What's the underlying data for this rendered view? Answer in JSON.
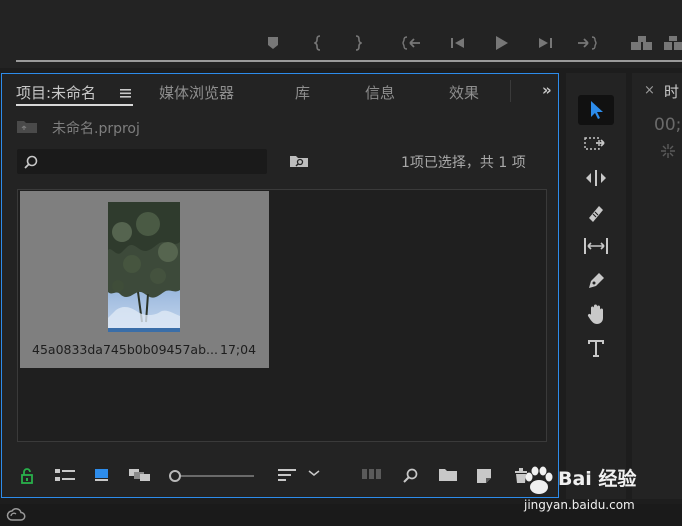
{
  "project_panel": {
    "tabs": [
      {
        "label": "项目:未命名"
      },
      {
        "label": "媒体浏览器"
      },
      {
        "label": "库"
      },
      {
        "label": "信息"
      },
      {
        "label": "效果"
      }
    ],
    "overflow_label": "»",
    "path": "未命名.prproj",
    "search": {
      "value": "",
      "placeholder": ""
    },
    "selection_info": "1项已选择，共 1 项",
    "items": [
      {
        "name": "45a0833da745b0b09457ab...",
        "duration": "17;04"
      }
    ]
  },
  "timeline": {
    "close_label": "×",
    "title_fragment": "时",
    "timecode_fragment": "00;"
  },
  "watermark": {
    "text": "Bai 经验",
    "url": "jingyan.baidu.com"
  },
  "colors": {
    "accent": "#2d8ceb",
    "lock_green": "#28b04a",
    "selected_tool": "#2d8ceb"
  }
}
